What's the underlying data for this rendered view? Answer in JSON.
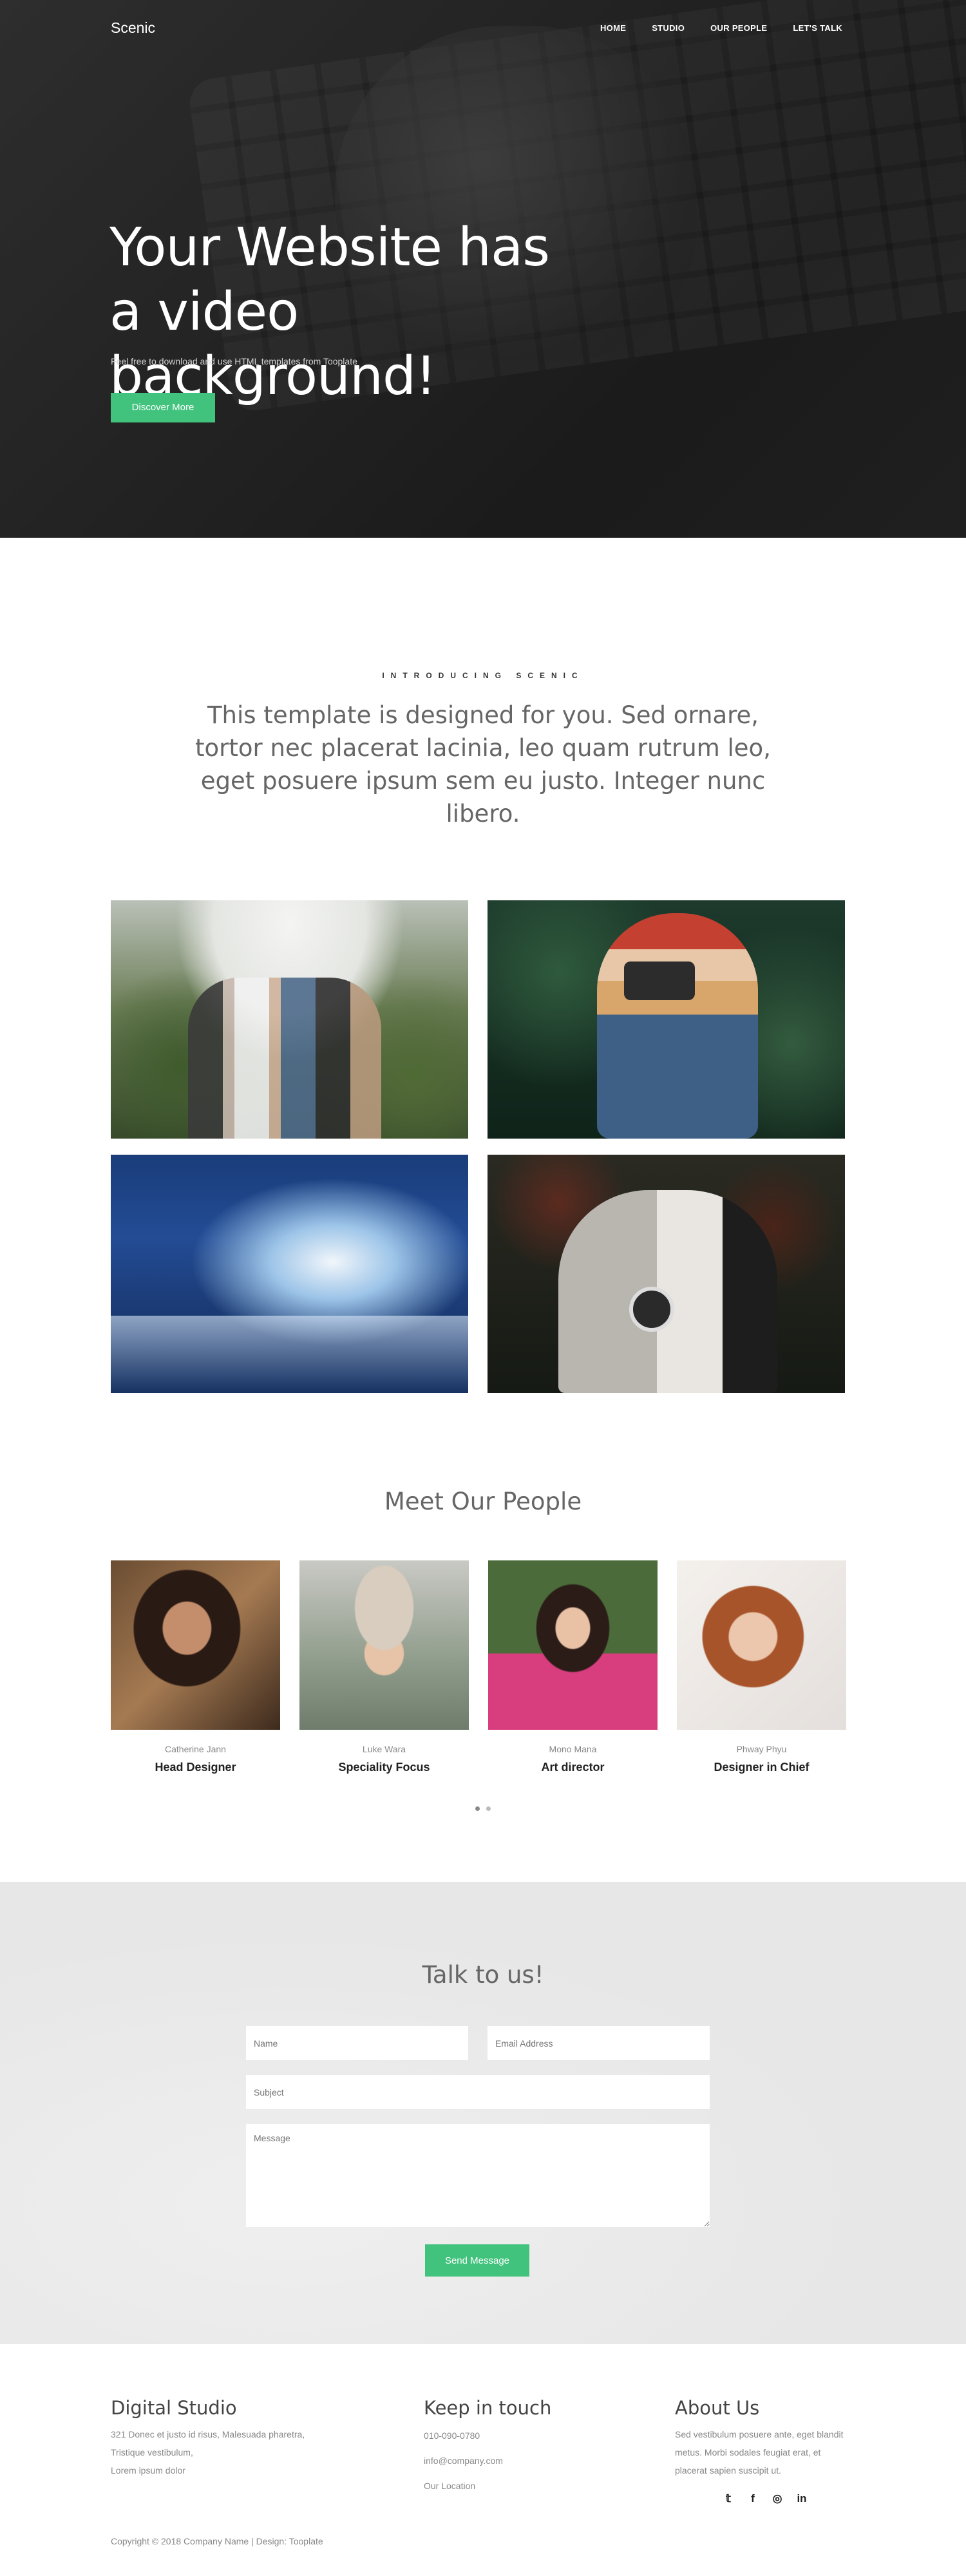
{
  "nav": {
    "brand": "Scenic",
    "items": [
      "HOME",
      "STUDIO",
      "OUR PEOPLE",
      "LET'S TALK"
    ]
  },
  "hero": {
    "title": "Your Website has a video background!",
    "subtitle": "Feel free to download and use HTML templates from Tooplate",
    "cta": "Discover More"
  },
  "intro": {
    "kicker": "INTRODUCING SCENIC",
    "text": "This template is designed for you. Sed ornare, tortor nec placerat lacinia, leo quam rutrum leo, eget posuere ipsum sem eu justo. Integer nunc libero."
  },
  "people": {
    "title": "Meet Our People",
    "members": [
      {
        "name": "Catherine Jann",
        "role": "Head Designer"
      },
      {
        "name": "Luke Wara",
        "role": "Speciality Focus"
      },
      {
        "name": "Mono Mana",
        "role": "Art director"
      },
      {
        "name": "Phway Phyu",
        "role": "Designer in Chief"
      }
    ]
  },
  "contact": {
    "title": "Talk to us!",
    "name_placeholder": "Name",
    "email_placeholder": "Email Address",
    "subject_placeholder": "Subject",
    "message_placeholder": "Message",
    "send": "Send Message"
  },
  "footer": {
    "studio": {
      "title": "Digital Studio",
      "address_1": "321 Donec et justo id risus, Malesuada pharetra,",
      "address_2": "Tristique vestibulum,",
      "address_3": "Lorem ipsum dolor"
    },
    "keep": {
      "title": "Keep in touch",
      "phone": "010-090-0780",
      "email": "info@company.com",
      "location": "Our Location"
    },
    "about": {
      "title": "About Us",
      "text": "Sed vestibulum posuere ante, eget blandit metus. Morbi sodales feugiat erat, et placerat sapien suscipit ut."
    },
    "socials": {
      "twitter": "twitter-icon",
      "facebook": "facebook-icon",
      "instagram": "instagram-icon",
      "linkedin": "linkedin-icon"
    },
    "copyright": "Copyright © 2018 Company Name | Design: Tooplate"
  }
}
